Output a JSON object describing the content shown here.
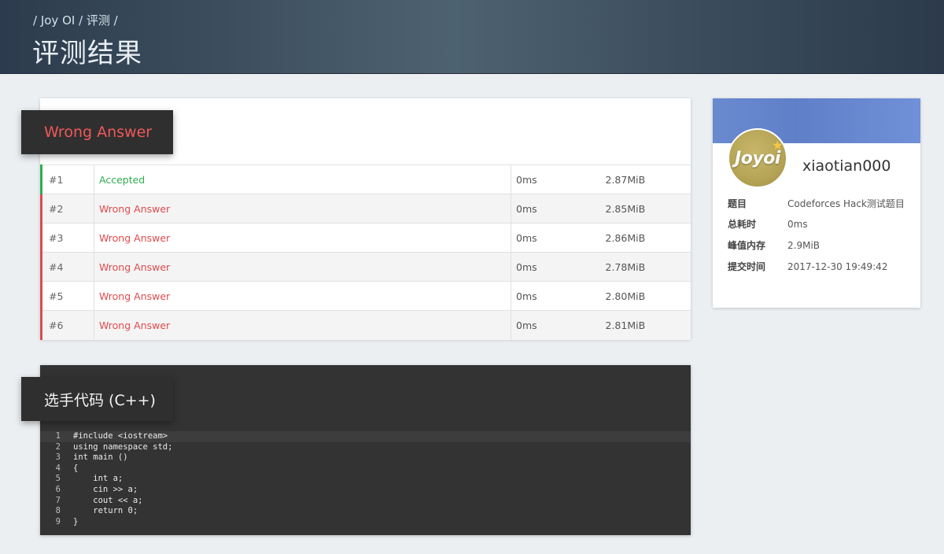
{
  "header": {
    "breadcrumb": "/ Joy OI / 评测 /",
    "title": "评测结果"
  },
  "result": {
    "verdict": "Wrong Answer",
    "colors": {
      "accepted": "#2fae4f",
      "wrong": "#e04a4c"
    },
    "cases": [
      {
        "num": "#1",
        "status": "Accepted",
        "time": "0ms",
        "memory": "2.87MiB"
      },
      {
        "num": "#2",
        "status": "Wrong Answer",
        "time": "0ms",
        "memory": "2.85MiB"
      },
      {
        "num": "#3",
        "status": "Wrong Answer",
        "time": "0ms",
        "memory": "2.86MiB"
      },
      {
        "num": "#4",
        "status": "Wrong Answer",
        "time": "0ms",
        "memory": "2.78MiB"
      },
      {
        "num": "#5",
        "status": "Wrong Answer",
        "time": "0ms",
        "memory": "2.80MiB"
      },
      {
        "num": "#6",
        "status": "Wrong Answer",
        "time": "0ms",
        "memory": "2.81MiB"
      }
    ]
  },
  "code": {
    "title": "选手代码 (C++)",
    "lines": [
      {
        "n": "1",
        "text": "#include <iostream>"
      },
      {
        "n": "2",
        "text": "using namespace std;"
      },
      {
        "n": "3",
        "text": "int main ()"
      },
      {
        "n": "4",
        "text": "{"
      },
      {
        "n": "5",
        "text": "    int a;"
      },
      {
        "n": "6",
        "text": "    cin >> a;"
      },
      {
        "n": "7",
        "text": "    cout << a;"
      },
      {
        "n": "8",
        "text": "    return 0;"
      },
      {
        "n": "9",
        "text": "}"
      }
    ]
  },
  "user": {
    "avatar_text": "Joyoi",
    "username": "xiaotian000",
    "info": [
      {
        "key": "题目",
        "value": "Codeforces Hack测试题目"
      },
      {
        "key": "总耗时",
        "value": "0ms"
      },
      {
        "key": "峰值内存",
        "value": "2.9MiB"
      },
      {
        "key": "提交时间",
        "value": "2017-12-30 19:49:42"
      }
    ]
  }
}
